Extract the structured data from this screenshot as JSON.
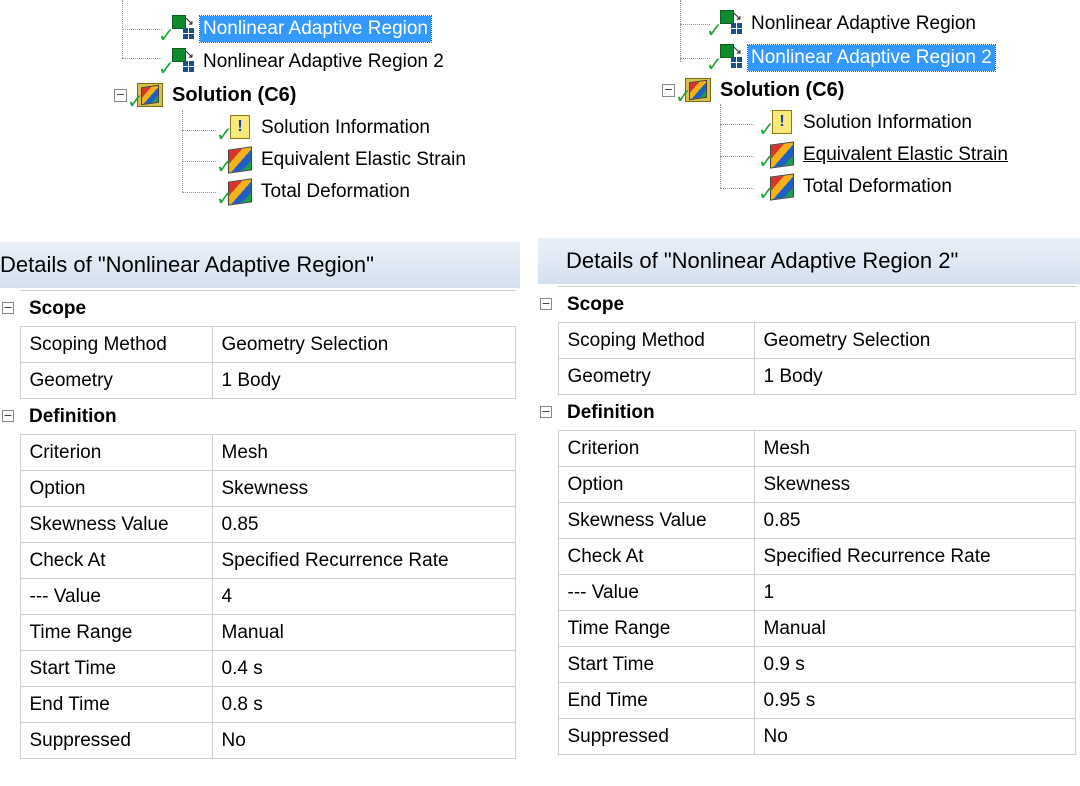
{
  "left": {
    "tree": {
      "nar1": "Nonlinear Adaptive Region",
      "nar2": "Nonlinear Adaptive Region 2",
      "solution": "Solution (C6)",
      "sol_info": "Solution Information",
      "ees": "Equivalent Elastic Strain",
      "total_def": "Total Deformation",
      "selected": "nar1"
    },
    "details": {
      "title": "Details of \"Nonlinear Adaptive Region\"",
      "scope_header": "Scope",
      "rows_scope": [
        {
          "label": "Scoping Method",
          "value": "Geometry Selection"
        },
        {
          "label": "Geometry",
          "value": "1 Body"
        }
      ],
      "definition_header": "Definition",
      "rows_def": [
        {
          "label": "Criterion",
          "value": "Mesh"
        },
        {
          "label": "Option",
          "value": "Skewness"
        },
        {
          "label": "Skewness Value",
          "value": "0.85"
        },
        {
          "label": "Check At",
          "value": "Specified Recurrence Rate"
        },
        {
          "label": "--- Value",
          "value": "4"
        },
        {
          "label": "Time Range",
          "value": "Manual"
        },
        {
          "label": "Start Time",
          "value": "0.4 s"
        },
        {
          "label": "End Time",
          "value": "0.8 s"
        },
        {
          "label": "Suppressed",
          "value": "No"
        }
      ]
    }
  },
  "right": {
    "tree": {
      "nar1": "Nonlinear Adaptive Region",
      "nar2": "Nonlinear Adaptive Region 2",
      "solution": "Solution (C6)",
      "sol_info": "Solution Information",
      "ees": "Equivalent Elastic Strain",
      "total_def": "Total Deformation",
      "selected": "nar2"
    },
    "details": {
      "title": "Details of \"Nonlinear Adaptive Region 2\"",
      "scope_header": "Scope",
      "rows_scope": [
        {
          "label": "Scoping Method",
          "value": "Geometry Selection"
        },
        {
          "label": "Geometry",
          "value": "1 Body"
        }
      ],
      "definition_header": "Definition",
      "rows_def": [
        {
          "label": "Criterion",
          "value": "Mesh"
        },
        {
          "label": "Option",
          "value": "Skewness"
        },
        {
          "label": "Skewness Value",
          "value": "0.85"
        },
        {
          "label": "Check At",
          "value": "Specified Recurrence Rate"
        },
        {
          "label": "--- Value",
          "value": "1"
        },
        {
          "label": "Time Range",
          "value": "Manual"
        },
        {
          "label": "Start Time",
          "value": "0.9 s"
        },
        {
          "label": "End Time",
          "value": "0.95 s"
        },
        {
          "label": "Suppressed",
          "value": "No"
        }
      ]
    }
  },
  "icons": {
    "nar": "nonlinear-adaptive-region-icon",
    "solution": "solution-icon",
    "info": "solution-information-icon",
    "result": "result-icon",
    "check": "check-icon"
  },
  "colors": {
    "selection": "#3399ff",
    "check": "#22a33a",
    "title_bg": "#dde6f2"
  }
}
